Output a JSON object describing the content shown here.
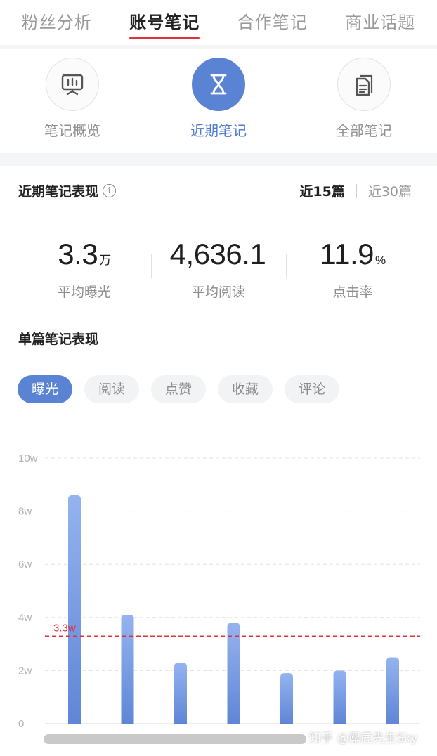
{
  "top_tabs": [
    {
      "label": "粉丝分析",
      "active": false
    },
    {
      "label": "账号笔记",
      "active": true
    },
    {
      "label": "合作笔记",
      "active": false
    },
    {
      "label": "商业话题",
      "active": false
    }
  ],
  "icon_nav": [
    {
      "label": "笔记概览",
      "icon": "presentation-board-icon",
      "active": false
    },
    {
      "label": "近期笔记",
      "icon": "hourglass-icon",
      "active": true
    },
    {
      "label": "全部笔记",
      "icon": "documents-icon",
      "active": false
    }
  ],
  "performance": {
    "title": "近期笔记表现",
    "info_icon": "info-icon",
    "ranges": [
      {
        "label": "近15篇",
        "active": true
      },
      {
        "label": "近30篇",
        "active": false
      }
    ],
    "stats": [
      {
        "value": "3.3",
        "unit": "万",
        "label": "平均曝光"
      },
      {
        "value": "4,636.1",
        "unit": "",
        "label": "平均阅读"
      },
      {
        "value": "11.9",
        "unit": "%",
        "label": "点击率"
      }
    ]
  },
  "single_note": {
    "title": "单篇笔记表现",
    "chips": [
      {
        "label": "曝光",
        "active": true
      },
      {
        "label": "阅读",
        "active": false
      },
      {
        "label": "点赞",
        "active": false
      },
      {
        "label": "收藏",
        "active": false
      },
      {
        "label": "评论",
        "active": false
      }
    ]
  },
  "chart_data": {
    "type": "bar",
    "title": "",
    "xlabel": "",
    "ylabel": "",
    "ylim": [
      0,
      10
    ],
    "y_ticks": [
      "0",
      "2w",
      "4w",
      "6w",
      "8w",
      "10w"
    ],
    "y_tick_values": [
      0,
      2,
      4,
      6,
      8,
      10
    ],
    "values": [
      8.6,
      4.1,
      2.3,
      3.8,
      1.9,
      2.0,
      2.5
    ],
    "average_line": {
      "value": 3.3,
      "label": "3.3w",
      "color": "#e0303a"
    },
    "bar_color_top": "#94b3ef",
    "bar_color_bottom": "#5f86d6",
    "grid": true
  },
  "watermark": "知乎 @麋鹿先生Sky",
  "colors": {
    "accent": "#5b83d4",
    "tab_underline": "#e0303a"
  }
}
